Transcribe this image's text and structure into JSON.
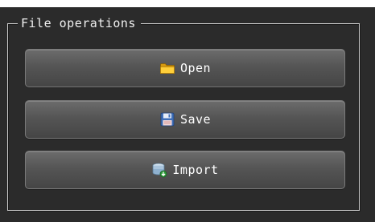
{
  "group": {
    "title": "File operations"
  },
  "buttons": {
    "open": {
      "label": "Open",
      "icon": "folder-icon"
    },
    "save": {
      "label": "Save",
      "icon": "floppy-disk-icon"
    },
    "import": {
      "label": "Import",
      "icon": "database-import-icon"
    }
  },
  "colors": {
    "panel_background": "#2b2b2b",
    "button_gradient_top": "#6c6c6c",
    "button_gradient_bottom": "#454545",
    "text": "#ffffff",
    "frame_line": "#c8c8c8"
  }
}
